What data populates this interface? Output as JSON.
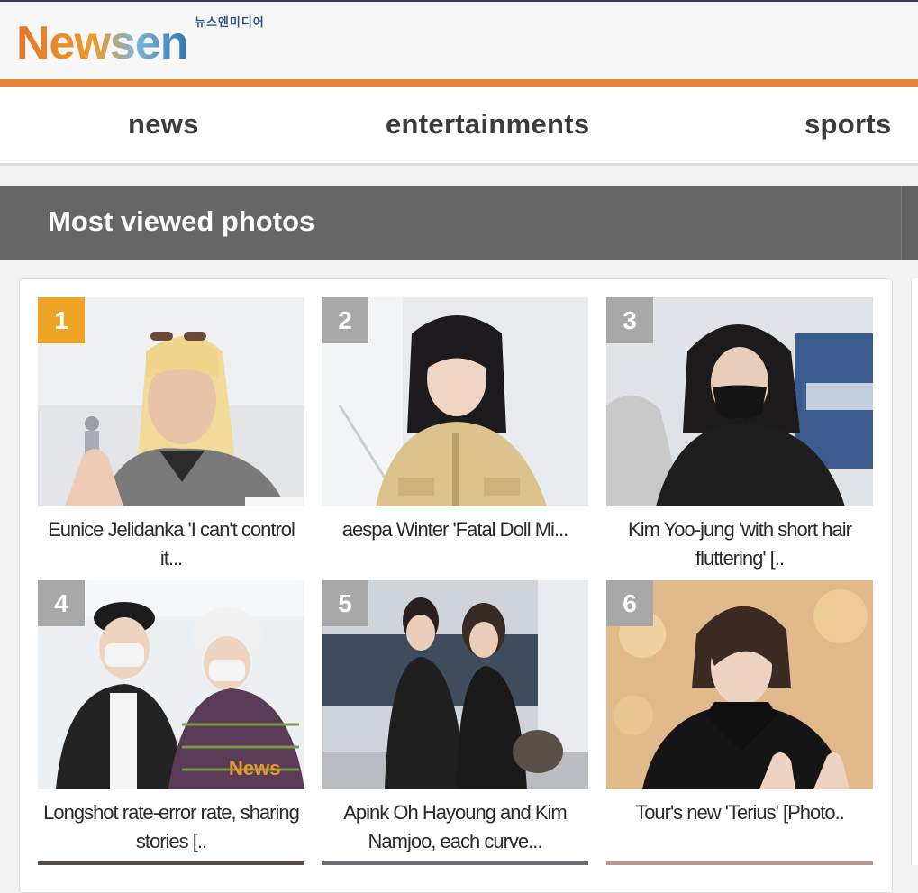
{
  "header": {
    "logo_text": "Newsen",
    "logo_korean": "뉴스엔미디어"
  },
  "nav": {
    "items": [
      {
        "label": "news"
      },
      {
        "label": "entertainments"
      },
      {
        "label": "sports"
      }
    ]
  },
  "section": {
    "title": "Most viewed photos"
  },
  "colors": {
    "brand_orange": "#e8823a",
    "rank_first": "#f0a426",
    "rank_other": "#a8a8a8",
    "section_bar": "#666666"
  },
  "photos": [
    {
      "rank": "1",
      "caption": "Eunice Jelidanka 'I can't control it...",
      "photo_subject": "blonde-woman-waving"
    },
    {
      "rank": "2",
      "caption": "aespa Winter 'Fatal Doll Mi...",
      "photo_subject": "woman-beige-jacket"
    },
    {
      "rank": "3",
      "caption": "Kim Yoo-jung 'with short hair fluttering' [..",
      "photo_subject": "woman-black-mask"
    },
    {
      "rank": "4",
      "caption": "Longshot rate-error rate, sharing stories [..",
      "photo_subject": "two-men-airport"
    },
    {
      "rank": "5",
      "caption": "Apink Oh Hayoung and Kim Namjoo, each curve...",
      "photo_subject": "two-women-black-leather"
    },
    {
      "rank": "6",
      "caption": "Tour's new 'Terius' [Photo..",
      "photo_subject": "man-black-scarf"
    }
  ]
}
